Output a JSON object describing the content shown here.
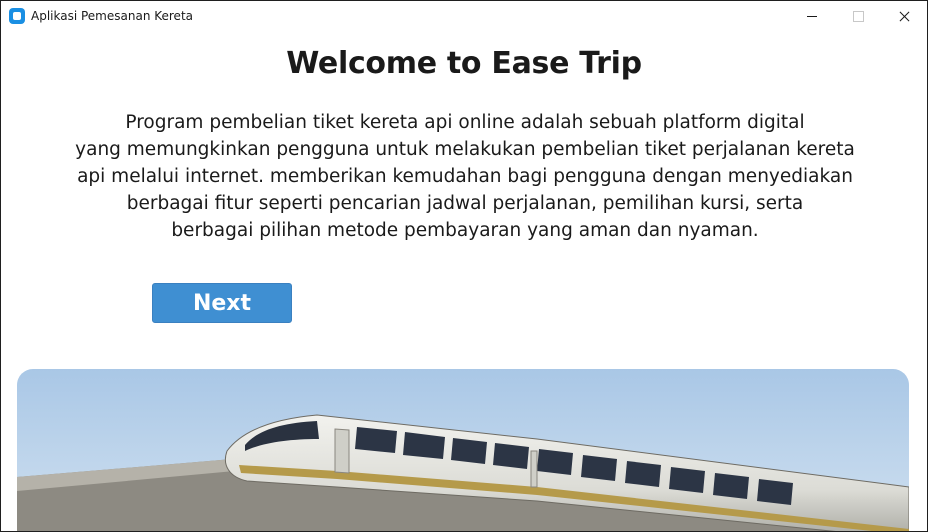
{
  "window": {
    "title": "Aplikasi Pemesanan Kereta"
  },
  "main": {
    "heading": "Welcome to Ease Trip",
    "description_lines": [
      "Program pembelian tiket kereta api online adalah sebuah platform digital",
      "yang memungkinkan pengguna untuk melakukan pembelian tiket perjalanan kereta",
      "api melalui internet. memberikan kemudahan bagi pengguna dengan menyediakan",
      "berbagai fitur seperti pencarian jadwal perjalanan, pemilihan kursi, serta",
      "berbagai pilihan metode pembayaran yang aman dan nyaman."
    ],
    "next_label": "Next"
  },
  "colors": {
    "accent": "#3f8fd2",
    "app_icon": "#1a8fe3",
    "text": "#1a1a1a"
  },
  "icons": {
    "app": "app-icon",
    "minimize": "minimize-icon",
    "maximize": "maximize-icon",
    "close": "close-icon"
  }
}
